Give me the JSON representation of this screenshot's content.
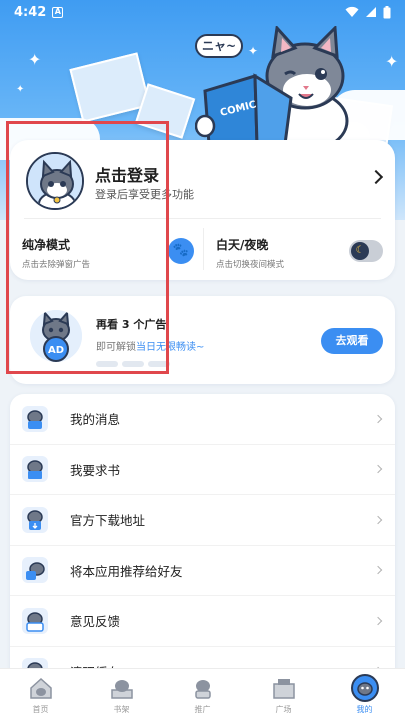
{
  "status_bar": {
    "time": "4:42",
    "notification_badge": "A"
  },
  "hero": {
    "speech_bubble": "ニャ~",
    "book_label": "COMIC"
  },
  "login": {
    "title": "点击登录",
    "subtitle": "登录后享受更多功能"
  },
  "modes": {
    "pure": {
      "title": "纯净模式",
      "subtitle": "点击去除弹窗广告"
    },
    "daynight": {
      "title": "白天/夜晚",
      "subtitle": "点击切换夜间模式"
    }
  },
  "ad": {
    "title": "再看 3 个广告",
    "subtitle_prefix": "即可解锁",
    "subtitle_highlight": "当日无限畅读~",
    "badge": "AD",
    "button": "去观看"
  },
  "menu": [
    {
      "label": "我的消息",
      "icon": "cat-message-icon"
    },
    {
      "label": "我要求书",
      "icon": "cat-request-icon"
    },
    {
      "label": "官方下载地址",
      "icon": "cat-download-icon"
    },
    {
      "label": "将本应用推荐给好友",
      "icon": "cat-share-icon"
    },
    {
      "label": "意见反馈",
      "icon": "cat-feedback-icon"
    },
    {
      "label": "清理缓存",
      "icon": "cat-clear-cache-icon"
    }
  ],
  "bottom_nav": [
    {
      "label": "首页",
      "icon": "home-icon",
      "active": false
    },
    {
      "label": "书架",
      "icon": "bookshelf-icon",
      "active": false
    },
    {
      "label": "推广",
      "icon": "promote-icon",
      "active": false
    },
    {
      "label": "广场",
      "icon": "plaza-icon",
      "active": false
    },
    {
      "label": "我的",
      "icon": "profile-icon",
      "active": true
    }
  ],
  "colors": {
    "accent": "#3b8ef2",
    "hero_top": "#3f9cf2",
    "highlight_box": "#e0474c"
  }
}
